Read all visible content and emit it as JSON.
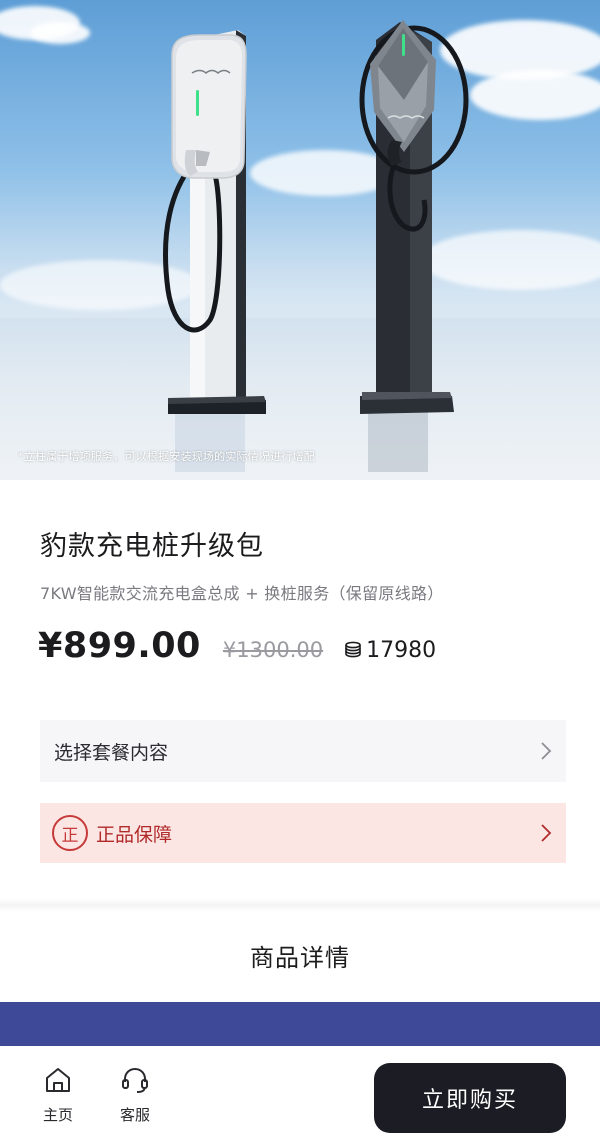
{
  "hero": {
    "note": "*立柱属于增项服务，可以根据安装现场的实际情况进行增配"
  },
  "product": {
    "title": "豹款充电桩升级包",
    "subtitle": "7KW智能款交流充电盒总成 + 换桩服务（保留原线路）",
    "price": "¥899.00",
    "original_price": "¥1300.00",
    "coin_icon": "coin-stack-icon",
    "coin_value": "17980"
  },
  "options": {
    "package_label": "选择套餐内容",
    "authentic_badge": "正",
    "authentic_label": "正品保障"
  },
  "details": {
    "title": "商品详情"
  },
  "bottom_bar": {
    "home_label": "主页",
    "home_icon": "home-icon",
    "service_label": "客服",
    "service_icon": "headset-icon",
    "buy_label": "立即购买"
  },
  "colors": {
    "accent_dark": "#1c1c24",
    "authentic_bg": "#fce6e4",
    "authentic_red": "#c63a3a",
    "detail_band": "#3e4a97"
  }
}
